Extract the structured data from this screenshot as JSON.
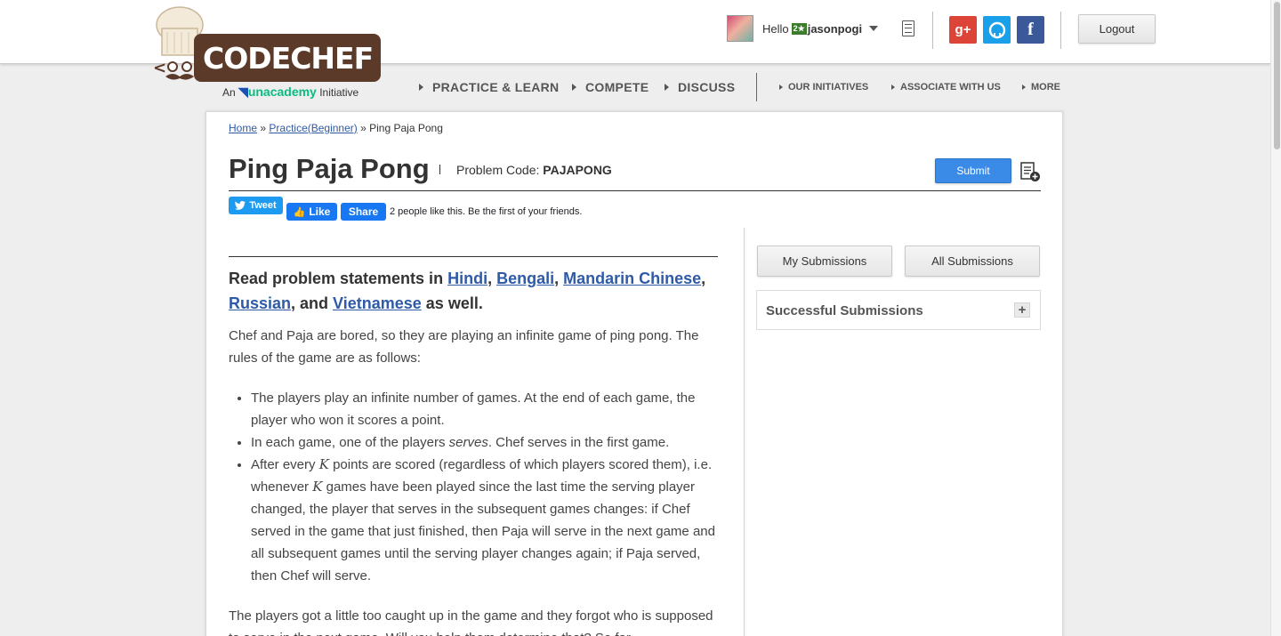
{
  "header": {
    "logo_text": "CODECHEF",
    "tagline_prefix": "An",
    "tagline_brand": "unacademy",
    "tagline_suffix": "Initiative",
    "greeting": "Hello",
    "rank": "2★",
    "username": "jasonpogi",
    "logout_label": "Logout",
    "social": [
      {
        "name": "google-plus",
        "glyph": "g+"
      },
      {
        "name": "github",
        "glyph": "◯"
      },
      {
        "name": "facebook",
        "glyph": "f"
      }
    ]
  },
  "nav": {
    "primary": [
      "PRACTICE & LEARN",
      "COMPETE",
      "DISCUSS"
    ],
    "secondary": [
      "OUR INITIATIVES",
      "ASSOCIATE WITH US",
      "MORE"
    ]
  },
  "breadcrumb": {
    "home": "Home",
    "sep": "»",
    "practice": "Practice(Beginner)",
    "current": "Ping Paja Pong"
  },
  "problem": {
    "title": "Ping Paja Pong",
    "code_label": "Problem Code:",
    "code": "PAJAPONG",
    "submit_label": "Submit"
  },
  "social_share": {
    "tweet": "Tweet",
    "like": "Like",
    "share": "Share",
    "like_text": "2 people like this. Be the first of your friends."
  },
  "statement": {
    "read_prefix": "Read problem statements in",
    "languages": [
      "Hindi",
      "Bengali",
      "Mandarin Chinese",
      "Russian",
      "Vietnamese"
    ],
    "read_suffix": "as well.",
    "intro": "Chef and Paja are bored, so they are playing an infinite game of ping pong. The rules of the game are as follows:",
    "rule1": "The players play an infinite number of games. At the end of each game, the player who won it scores a point.",
    "rule2_a": "In each game, one of the players",
    "rule2_em": "serves",
    "rule2_b": ". Chef serves in the first game.",
    "rule3_a": "After every",
    "rule3_var": "K",
    "rule3_b": "points are scored (regardless of which players scored them), i.e. whenever",
    "rule3_c": "games have been played since the last time the serving player changed, the player that serves in the subsequent games changes: if Chef served in the game that just finished, then Paja will serve in the next game and all subsequent games until the serving player changes again; if Paja served, then Chef will serve.",
    "outro": "The players got a little too caught up in the game and they forgot who is supposed to serve in the next game. Will you help them determine that? So far,"
  },
  "sidebar": {
    "my_submissions": "My Submissions",
    "all_submissions": "All Submissions",
    "successful_submissions": "Successful Submissions",
    "expand": "+"
  }
}
